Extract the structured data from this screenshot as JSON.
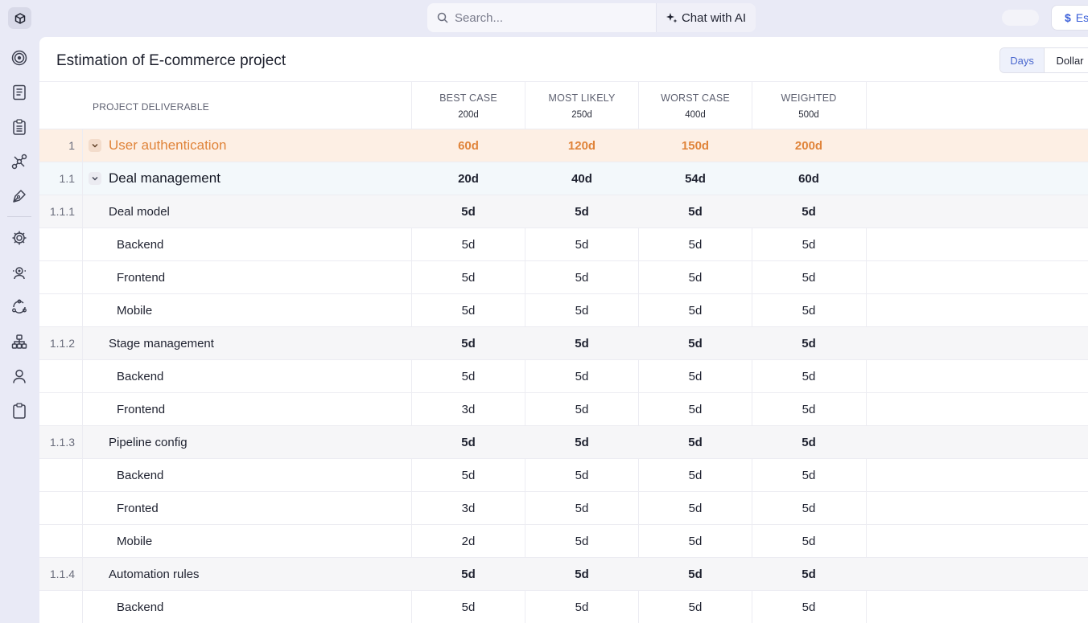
{
  "topbar": {
    "search_placeholder": "Search...",
    "chat_ai_label": "Chat with AI",
    "currency_button_label": "Es"
  },
  "sidebar": {
    "icons": [
      "cube-logo-icon",
      "target-icon",
      "document-icon",
      "clipboard-list-icon",
      "network-icon",
      "pen-tool-icon",
      "settings-icon",
      "users-gear-icon",
      "cycle-icon",
      "org-chart-icon",
      "user-icon",
      "clipboard-icon"
    ]
  },
  "panel": {
    "title": "Estimation of E-commerce project",
    "toggle": {
      "days_label": "Days",
      "dollar_label": "Dollar",
      "selected": "Days"
    }
  },
  "table": {
    "deliverable_header": "PROJECT DELIVERABLE",
    "columns": [
      {
        "label": "BEST CASE",
        "total": "200d"
      },
      {
        "label": "MOST LIKELY",
        "total": "250d"
      },
      {
        "label": "WORST CASE",
        "total": "400d"
      },
      {
        "label": "WEIGHTED",
        "total": "500d"
      }
    ],
    "rows": [
      {
        "num": "1",
        "name": "User authentication",
        "values": [
          "60d",
          "120d",
          "150d",
          "200d"
        ]
      },
      {
        "num": "1.1",
        "name": "Deal management",
        "values": [
          "20d",
          "40d",
          "54d",
          "60d"
        ]
      },
      {
        "num": "1.1.1",
        "name": "Deal model",
        "values": [
          "5d",
          "5d",
          "5d",
          "5d"
        ]
      },
      {
        "num": "",
        "name": "Backend",
        "values": [
          "5d",
          "5d",
          "5d",
          "5d"
        ]
      },
      {
        "num": "",
        "name": "Frontend",
        "values": [
          "5d",
          "5d",
          "5d",
          "5d"
        ]
      },
      {
        "num": "",
        "name": "Mobile",
        "values": [
          "5d",
          "5d",
          "5d",
          "5d"
        ]
      },
      {
        "num": "1.1.2",
        "name": "Stage management",
        "values": [
          "5d",
          "5d",
          "5d",
          "5d"
        ]
      },
      {
        "num": "",
        "name": "Backend",
        "values": [
          "5d",
          "5d",
          "5d",
          "5d"
        ]
      },
      {
        "num": "",
        "name": "Frontend",
        "values": [
          "3d",
          "5d",
          "5d",
          "5d"
        ]
      },
      {
        "num": "1.1.3",
        "name": "Pipeline config",
        "values": [
          "5d",
          "5d",
          "5d",
          "5d"
        ]
      },
      {
        "num": "",
        "name": "Backend",
        "values": [
          "5d",
          "5d",
          "5d",
          "5d"
        ]
      },
      {
        "num": "",
        "name": "Fronted",
        "values": [
          "3d",
          "5d",
          "5d",
          "5d"
        ]
      },
      {
        "num": "",
        "name": "Mobile",
        "values": [
          "2d",
          "5d",
          "5d",
          "5d"
        ]
      },
      {
        "num": "1.1.4",
        "name": "Automation rules",
        "values": [
          "5d",
          "5d",
          "5d",
          "5d"
        ]
      },
      {
        "num": "",
        "name": "Backend",
        "values": [
          "5d",
          "5d",
          "5d",
          "5d"
        ]
      }
    ]
  }
}
